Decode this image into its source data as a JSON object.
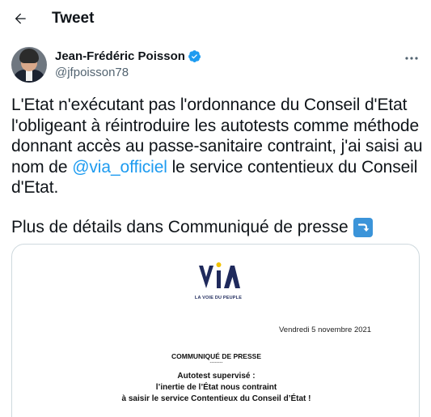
{
  "header": {
    "title": "Tweet",
    "back_icon": "arrow-left-icon"
  },
  "author": {
    "name": "Jean-Frédéric Poisson",
    "handle": "@jfpoisson78",
    "verified": true,
    "verified_color": "#1d9bf0",
    "more_icon": "more-horizontal-icon"
  },
  "tweet": {
    "text_before": "L'Etat n'exécutant pas l'ordonnance du Conseil d'Etat l'obligeant à réintroduire les autotests comme méthode donnant accès au passe-sanitaire contraint, j'ai saisi au nom de ",
    "mention": "@via_officiel",
    "text_after": " le service contentieux du Conseil d'Etat.",
    "line2": "Plus de détails dans Communiqué de presse",
    "emoji": "right-arrow-curving-down-icon",
    "link_color": "#1d9bf0"
  },
  "attachment": {
    "logo_text": "VIA",
    "logo_tagline": "LA VOIE DU PEUPLE",
    "date": "Vendredi 5 novembre 2021",
    "kind": "COMMUNIQUÉ DE PRESSE",
    "separator": "--------",
    "headline_1": "Autotest supervisé :",
    "headline_2": "l’inertie de l’État nous contraint",
    "headline_3": "à saisir le service Contentieux du Conseil d’État !",
    "logo_color": "#1f2a5c",
    "logo_accent": "#f2c200"
  }
}
